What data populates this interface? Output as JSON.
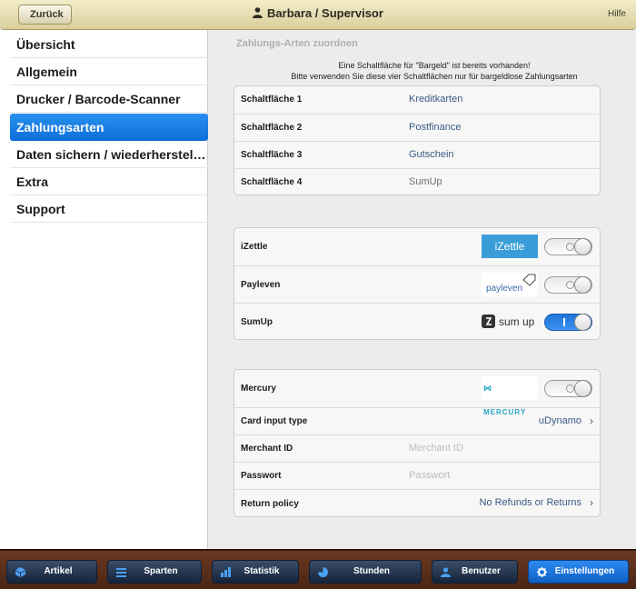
{
  "header": {
    "back_label": "Zurück",
    "title": "Barbara / Supervisor",
    "help_label": "Hilfe"
  },
  "sidebar": {
    "items": [
      {
        "label": "Übersicht",
        "active": false
      },
      {
        "label": "Allgemein",
        "active": false
      },
      {
        "label": "Drucker / Barcode-Scanner",
        "active": false
      },
      {
        "label": "Zahlungsarten",
        "active": true
      },
      {
        "label": "Daten sichern / wiederherstellen",
        "active": false
      },
      {
        "label": "Extra",
        "active": false
      },
      {
        "label": "Support",
        "active": false
      }
    ]
  },
  "main": {
    "section_title": "Zahlungs-Arten zuordnen",
    "note_line1": "Eine Schaltfläche für \"Bargeld\" ist bereits vorhanden!",
    "note_line2": "Bitte verwenden Sie diese vier Schaltflächen nur für bargeldlose Zahlungsarten",
    "buttons": [
      {
        "label": "Schaltfläche 1",
        "value": "Kreditkarten"
      },
      {
        "label": "Schaltfläche 2",
        "value": "Postfinance"
      },
      {
        "label": "Schaltfläche 3",
        "value": "Gutschein"
      },
      {
        "label": "Schaltfläche 4",
        "value": "SumUp"
      }
    ],
    "providers": [
      {
        "label": "iZettle",
        "logo_text": "iZettle",
        "enabled": false
      },
      {
        "label": "Payleven",
        "logo_text": "payleven",
        "enabled": false
      },
      {
        "label": "SumUp",
        "logo_text": "sum up",
        "enabled": true
      }
    ],
    "mercury": {
      "label": "Mercury",
      "logo_text": "MERCURY",
      "enabled": false,
      "card_input_label": "Card input type",
      "card_input_value": "uDynamo",
      "merchant_label": "Merchant ID",
      "merchant_placeholder": "Merchant ID",
      "password_label": "Passwort",
      "password_placeholder": "Passwort",
      "return_label": "Return policy",
      "return_value": "No Refunds or Returns"
    }
  },
  "tabbar": {
    "tabs": [
      {
        "label": "Artikel",
        "icon": "box-icon",
        "active": false
      },
      {
        "label": "Sparten",
        "icon": "list-icon",
        "active": false
      },
      {
        "label": "Statistik",
        "icon": "bar-chart-icon",
        "active": false
      },
      {
        "label": "Stunden",
        "icon": "pie-icon",
        "active": false
      },
      {
        "label": "Benutzer",
        "icon": "user-icon",
        "active": false
      },
      {
        "label": "Einstellungen",
        "icon": "gear-icon",
        "active": true
      }
    ]
  },
  "colors": {
    "accent_blue": "#0c6fd8",
    "link_blue": "#3a5b85",
    "izettle_blue": "#3a9dd8",
    "header_gold": "#d9cf9d",
    "tabbar_wood": "#4a2414"
  }
}
